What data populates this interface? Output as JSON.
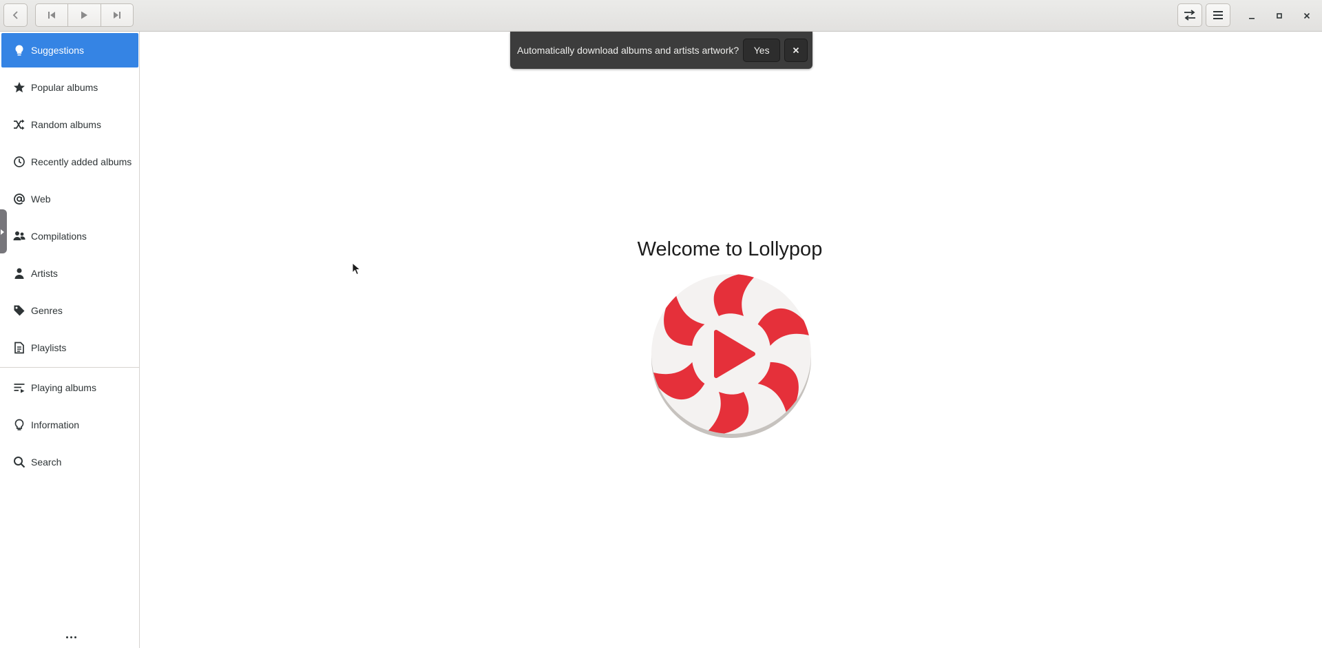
{
  "headerbar": {
    "back_icon": "chevron-left-icon",
    "prev_icon": "skip-previous-icon",
    "play_icon": "play-icon",
    "next_icon": "skip-next-icon",
    "repeat_icon": "repeat-shuffle-icon",
    "menu_icon": "hamburger-menu-icon"
  },
  "sidebar": {
    "items": [
      {
        "label": "Suggestions",
        "icon": "lightbulb-icon",
        "active": true
      },
      {
        "label": "Popular albums",
        "icon": "star-icon"
      },
      {
        "label": "Random albums",
        "icon": "shuffle-icon"
      },
      {
        "label": "Recently added albums",
        "icon": "clock-icon"
      },
      {
        "label": "Web",
        "icon": "at-icon"
      },
      {
        "label": "Compilations",
        "icon": "people-icon"
      },
      {
        "label": "Artists",
        "icon": "person-icon"
      },
      {
        "label": "Genres",
        "icon": "tag-icon"
      },
      {
        "label": "Playlists",
        "icon": "document-list-icon"
      },
      {
        "label": "Playing albums",
        "icon": "queue-icon"
      },
      {
        "label": "Information",
        "icon": "lightbulb-icon"
      },
      {
        "label": "Search",
        "icon": "search-icon"
      }
    ]
  },
  "infobar": {
    "message": "Automatically download albums and artists artwork?",
    "yes_label": "Yes"
  },
  "main": {
    "welcome_title": "Welcome to Lollypop"
  },
  "colors": {
    "accent": "#3584e4",
    "logo_red": "#e5303a",
    "infobar_bg": "#3c3c3c"
  }
}
